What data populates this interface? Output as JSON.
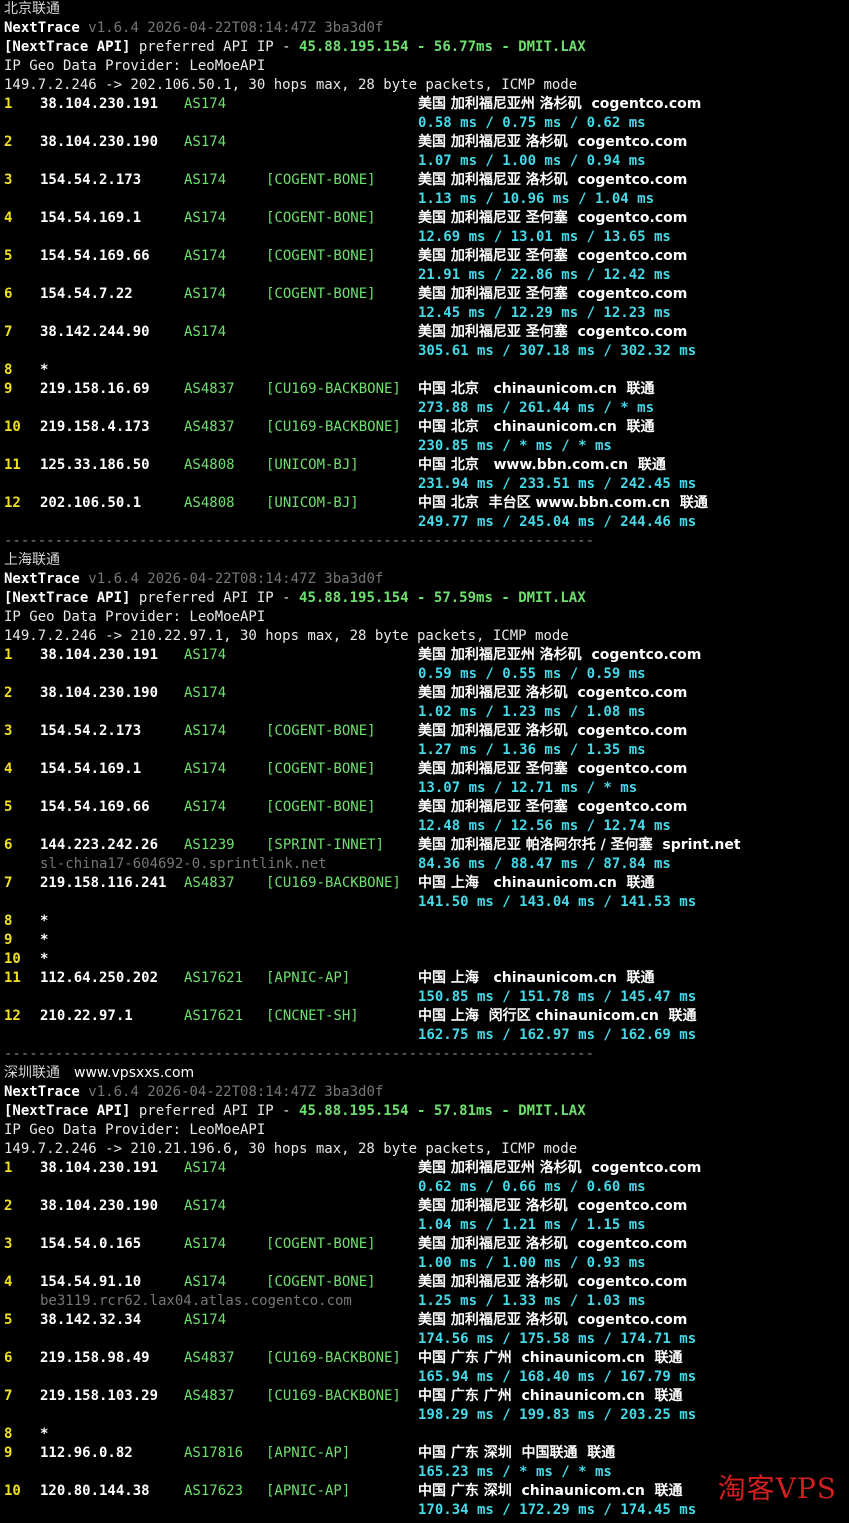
{
  "blocks": [
    {
      "title": "北京联通",
      "site": "",
      "nt_name": "NextTrace",
      "nt_version": "v1.6.4 2026-04-22T08:14:47Z 3ba3d0f",
      "api_label": "[NextTrace API]",
      "api_text": "preferred API IP - ",
      "api_ip": "45.88.195.154",
      "api_dash": " - ",
      "api_ms": "56.77ms",
      "api_dash2": " - ",
      "api_pop": "DMIT.LAX",
      "provider": "IP Geo Data Provider: LeoMoeAPI",
      "route": "149.7.2.246 -> 202.106.50.1, 30 hops max, 28 byte packets, ICMP mode",
      "hops": [
        {
          "no": "1",
          "ip": "38.104.230.191",
          "as": "AS174",
          "tag": "",
          "geo": "美国 加利福尼亚州 洛杉矶  cogentco.com",
          "rtt": "0.58 ms / 0.75 ms / 0.62 ms",
          "host": ""
        },
        {
          "no": "2",
          "ip": "38.104.230.190",
          "as": "AS174",
          "tag": "",
          "geo": "美国 加利福尼亚 洛杉矶  cogentco.com",
          "rtt": "1.07 ms / 1.00 ms / 0.94 ms",
          "host": ""
        },
        {
          "no": "3",
          "ip": "154.54.2.173",
          "as": "AS174",
          "tag": "[COGENT-BONE]",
          "geo": "美国 加利福尼亚 洛杉矶  cogentco.com",
          "rtt": "1.13 ms / 10.96 ms / 1.04 ms",
          "host": ""
        },
        {
          "no": "4",
          "ip": "154.54.169.1",
          "as": "AS174",
          "tag": "[COGENT-BONE]",
          "geo": "美国 加利福尼亚 圣何塞  cogentco.com",
          "rtt": "12.69 ms / 13.01 ms / 13.65 ms",
          "host": ""
        },
        {
          "no": "5",
          "ip": "154.54.169.66",
          "as": "AS174",
          "tag": "[COGENT-BONE]",
          "geo": "美国 加利福尼亚 圣何塞  cogentco.com",
          "rtt": "21.91 ms / 22.86 ms / 12.42 ms",
          "host": ""
        },
        {
          "no": "6",
          "ip": "154.54.7.22",
          "as": "AS174",
          "tag": "[COGENT-BONE]",
          "geo": "美国 加利福尼亚 圣何塞  cogentco.com",
          "rtt": "12.45 ms / 12.29 ms / 12.23 ms",
          "host": ""
        },
        {
          "no": "7",
          "ip": "38.142.244.90",
          "as": "AS174",
          "tag": "",
          "geo": "美国 加利福尼亚 圣何塞  cogentco.com",
          "rtt": "305.61 ms / 307.18 ms / 302.32 ms",
          "host": ""
        },
        {
          "no": "8",
          "ip": "*",
          "as": "",
          "tag": "",
          "geo": "",
          "rtt": "",
          "host": ""
        },
        {
          "no": "9",
          "ip": "219.158.16.69",
          "as": "AS4837",
          "tag": "[CU169-BACKBONE]",
          "geo": "中国 北京   chinaunicom.cn  联通",
          "rtt": "273.88 ms / 261.44 ms / * ms",
          "host": ""
        },
        {
          "no": "10",
          "ip": "219.158.4.173",
          "as": "AS4837",
          "tag": "[CU169-BACKBONE]",
          "geo": "中国 北京   chinaunicom.cn  联通",
          "rtt": "230.85 ms / * ms / * ms",
          "host": ""
        },
        {
          "no": "11",
          "ip": "125.33.186.50",
          "as": "AS4808",
          "tag": "[UNICOM-BJ]",
          "geo": "中国 北京   www.bbn.com.cn  联通",
          "rtt": "231.94 ms / 233.51 ms / 242.45 ms",
          "host": ""
        },
        {
          "no": "12",
          "ip": "202.106.50.1",
          "as": "AS4808",
          "tag": "[UNICOM-BJ]",
          "geo": "中国 北京  丰台区 www.bbn.com.cn  联通",
          "rtt": "249.77 ms / 245.04 ms / 244.46 ms",
          "host": ""
        }
      ]
    },
    {
      "title": "上海联通",
      "site": "",
      "nt_name": "NextTrace",
      "nt_version": "v1.6.4 2026-04-22T08:14:47Z 3ba3d0f",
      "api_label": "[NextTrace API]",
      "api_text": "preferred API IP - ",
      "api_ip": "45.88.195.154",
      "api_dash": " - ",
      "api_ms": "57.59ms",
      "api_dash2": " - ",
      "api_pop": "DMIT.LAX",
      "provider": "IP Geo Data Provider: LeoMoeAPI",
      "route": "149.7.2.246 -> 210.22.97.1, 30 hops max, 28 byte packets, ICMP mode",
      "hops": [
        {
          "no": "1",
          "ip": "38.104.230.191",
          "as": "AS174",
          "tag": "",
          "geo": "美国 加利福尼亚州 洛杉矶  cogentco.com",
          "rtt": "0.59 ms / 0.55 ms / 0.59 ms",
          "host": ""
        },
        {
          "no": "2",
          "ip": "38.104.230.190",
          "as": "AS174",
          "tag": "",
          "geo": "美国 加利福尼亚 洛杉矶  cogentco.com",
          "rtt": "1.02 ms / 1.23 ms / 1.08 ms",
          "host": ""
        },
        {
          "no": "3",
          "ip": "154.54.2.173",
          "as": "AS174",
          "tag": "[COGENT-BONE]",
          "geo": "美国 加利福尼亚 洛杉矶  cogentco.com",
          "rtt": "1.27 ms / 1.36 ms / 1.35 ms",
          "host": ""
        },
        {
          "no": "4",
          "ip": "154.54.169.1",
          "as": "AS174",
          "tag": "[COGENT-BONE]",
          "geo": "美国 加利福尼亚 圣何塞  cogentco.com",
          "rtt": "13.07 ms / 12.71 ms / * ms",
          "host": ""
        },
        {
          "no": "5",
          "ip": "154.54.169.66",
          "as": "AS174",
          "tag": "[COGENT-BONE]",
          "geo": "美国 加利福尼亚 圣何塞  cogentco.com",
          "rtt": "12.48 ms / 12.56 ms / 12.74 ms",
          "host": ""
        },
        {
          "no": "6",
          "ip": "144.223.242.26",
          "as": "AS1239",
          "tag": "[SPRINT-INNET]",
          "geo": "美国 加利福尼亚 帕洛阿尔托 / 圣何塞  sprint.net",
          "rtt": "84.36 ms / 88.47 ms / 87.84 ms",
          "host": "sl-china17-604692-0.sprintlink.net"
        },
        {
          "no": "7",
          "ip": "219.158.116.241",
          "as": "AS4837",
          "tag": "[CU169-BACKBONE]",
          "geo": "中国 上海   chinaunicom.cn  联通",
          "rtt": "141.50 ms / 143.04 ms / 141.53 ms",
          "host": ""
        },
        {
          "no": "8",
          "ip": "*",
          "as": "",
          "tag": "",
          "geo": "",
          "rtt": "",
          "host": ""
        },
        {
          "no": "9",
          "ip": "*",
          "as": "",
          "tag": "",
          "geo": "",
          "rtt": "",
          "host": ""
        },
        {
          "no": "10",
          "ip": "*",
          "as": "",
          "tag": "",
          "geo": "",
          "rtt": "",
          "host": ""
        },
        {
          "no": "11",
          "ip": "112.64.250.202",
          "as": "AS17621",
          "tag": "[APNIC-AP]",
          "geo": "中国 上海   chinaunicom.cn  联通",
          "rtt": "150.85 ms / 151.78 ms / 145.47 ms",
          "host": ""
        },
        {
          "no": "12",
          "ip": "210.22.97.1",
          "as": "AS17621",
          "tag": "[CNCNET-SH]",
          "geo": "中国 上海  闵行区 chinaunicom.cn  联通",
          "rtt": "162.75 ms / 162.97 ms / 162.69 ms",
          "host": ""
        }
      ]
    },
    {
      "title": "深圳联通",
      "site": "www.vpsxxs.com",
      "nt_name": "NextTrace",
      "nt_version": "v1.6.4 2026-04-22T08:14:47Z 3ba3d0f",
      "api_label": "[NextTrace API]",
      "api_text": "preferred API IP - ",
      "api_ip": "45.88.195.154",
      "api_dash": " - ",
      "api_ms": "57.81ms",
      "api_dash2": " - ",
      "api_pop": "DMIT.LAX",
      "provider": "IP Geo Data Provider: LeoMoeAPI",
      "route": "149.7.2.246 -> 210.21.196.6, 30 hops max, 28 byte packets, ICMP mode",
      "hops": [
        {
          "no": "1",
          "ip": "38.104.230.191",
          "as": "AS174",
          "tag": "",
          "geo": "美国 加利福尼亚州 洛杉矶  cogentco.com",
          "rtt": "0.62 ms / 0.66 ms / 0.60 ms",
          "host": ""
        },
        {
          "no": "2",
          "ip": "38.104.230.190",
          "as": "AS174",
          "tag": "",
          "geo": "美国 加利福尼亚 洛杉矶  cogentco.com",
          "rtt": "1.04 ms / 1.21 ms / 1.15 ms",
          "host": ""
        },
        {
          "no": "3",
          "ip": "154.54.0.165",
          "as": "AS174",
          "tag": "[COGENT-BONE]",
          "geo": "美国 加利福尼亚 洛杉矶  cogentco.com",
          "rtt": "1.00 ms / 1.00 ms / 0.93 ms",
          "host": ""
        },
        {
          "no": "4",
          "ip": "154.54.91.10",
          "as": "AS174",
          "tag": "[COGENT-BONE]",
          "geo": "美国 加利福尼亚 洛杉矶  cogentco.com",
          "rtt": "1.25 ms / 1.33 ms / 1.03 ms",
          "host": "be3119.rcr62.lax04.atlas.cogentco.com"
        },
        {
          "no": "5",
          "ip": "38.142.32.34",
          "as": "AS174",
          "tag": "",
          "geo": "美国 加利福尼亚 洛杉矶  cogentco.com",
          "rtt": "174.56 ms / 175.58 ms / 174.71 ms",
          "host": ""
        },
        {
          "no": "6",
          "ip": "219.158.98.49",
          "as": "AS4837",
          "tag": "[CU169-BACKBONE]",
          "geo": "中国 广东 广州  chinaunicom.cn  联通",
          "rtt": "165.94 ms / 168.40 ms / 167.79 ms",
          "host": ""
        },
        {
          "no": "7",
          "ip": "219.158.103.29",
          "as": "AS4837",
          "tag": "[CU169-BACKBONE]",
          "geo": "中国 广东 广州  chinaunicom.cn  联通",
          "rtt": "198.29 ms / 199.83 ms / 203.25 ms",
          "host": ""
        },
        {
          "no": "8",
          "ip": "*",
          "as": "",
          "tag": "",
          "geo": "",
          "rtt": "",
          "host": ""
        },
        {
          "no": "9",
          "ip": "112.96.0.82",
          "as": "AS17816",
          "tag": "[APNIC-AP]",
          "geo": "中国 广东 深圳  中国联通  联通",
          "rtt": "165.23 ms / * ms / * ms",
          "host": ""
        },
        {
          "no": "10",
          "ip": "120.80.144.38",
          "as": "AS17623",
          "tag": "[APNIC-AP]",
          "geo": "中国 广东 深圳  chinaunicom.cn  联通",
          "rtt": "170.34 ms / 172.29 ms / 174.45 ms",
          "host": ""
        }
      ]
    }
  ],
  "separator": "----------------------------------------------------------------------",
  "watermark": "淘客VPS"
}
